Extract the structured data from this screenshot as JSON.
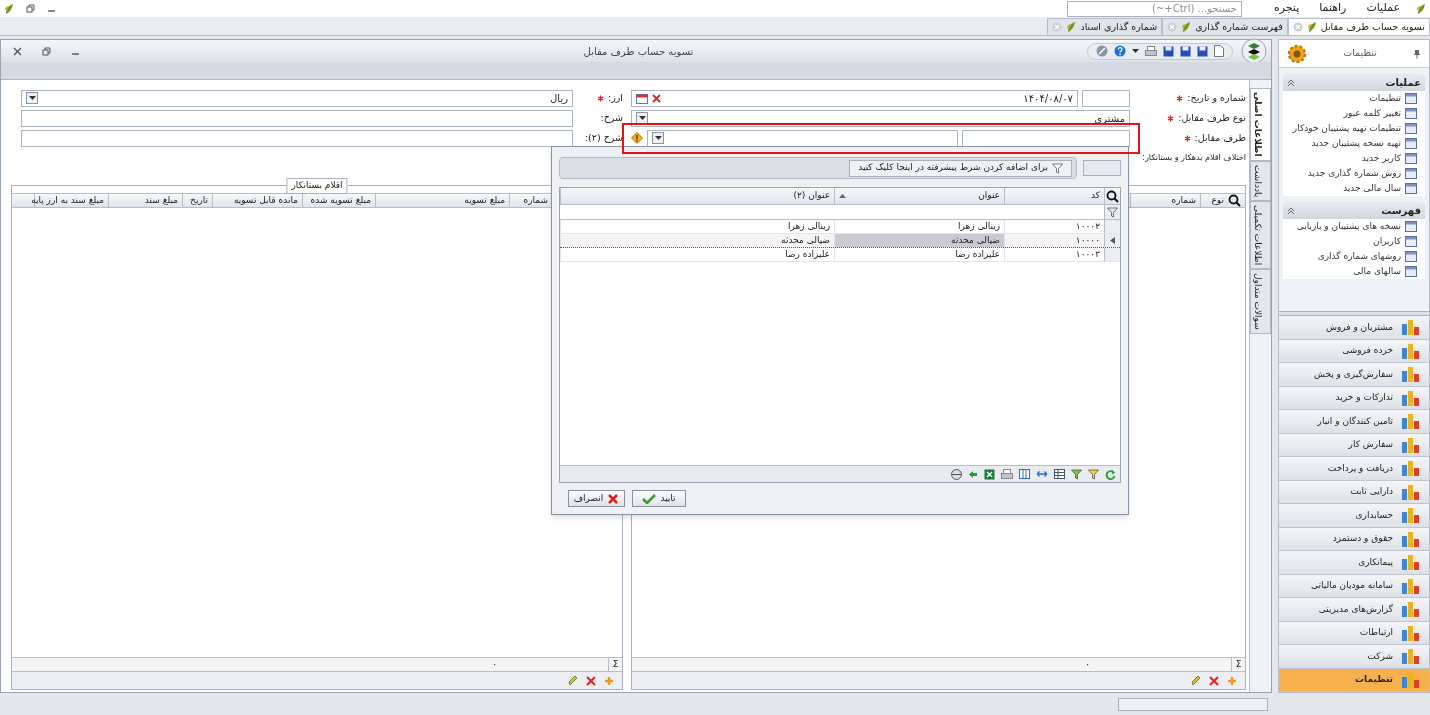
{
  "menu_bar": {
    "items": [
      "عملیات",
      "راهنما",
      "پنجره"
    ],
    "search": {
      "placeholder": "جستجو... (Ctrl+~)"
    }
  },
  "tabs": [
    {
      "label": "تسویه حساب طرف مقابل",
      "selected": true
    },
    {
      "label": "فهرست شماره گذاری",
      "selected": false
    },
    {
      "label": "شماره گذاری اسناد",
      "selected": false
    }
  ],
  "window": {
    "title": "تسویه حساب طرف مقابل"
  },
  "side_tabs": [
    {
      "label": "اطلاعات اصلی",
      "selected": true
    },
    {
      "label": "یادداشت",
      "selected": false
    },
    {
      "label": "اطلاعات تکمیلی",
      "selected": false
    },
    {
      "label": "سوالات متداول",
      "selected": false
    }
  ],
  "form_right": [
    {
      "kind": "number_date",
      "label": "شماره و تاریخ:",
      "required": true,
      "value": "۱۴۰۴/۰۸/۰۷"
    },
    {
      "kind": "combo",
      "label": "نوع طرف مقابل:",
      "required": true,
      "value": "مشتری"
    },
    {
      "kind": "lookup",
      "label": "طرف مقابل:",
      "required": true
    },
    {
      "kind": "caption",
      "label": "اختلاف اقلام بدهکار و بستانکار:",
      "required": false
    }
  ],
  "form_left": [
    {
      "kind": "combo",
      "label": "ارز:",
      "required": true,
      "value": "ریال"
    },
    {
      "kind": "text",
      "label": "شرح:",
      "required": false
    },
    {
      "kind": "text",
      "label": "شرح (۲):",
      "required": false
    }
  ],
  "debit_grid": {
    "columns": [
      "نوع",
      "شماره"
    ],
    "sum_symbol": "Σ",
    "total": "۰"
  },
  "credit_grid": {
    "title": "اقلام بستانکار",
    "columns": [
      "شماره",
      "مبلغ تسویه",
      "مبلغ تسویه شده",
      "مانده قابل تسویه",
      "تاریخ",
      "مبلغ سند",
      "مبلغ سند به ارز پایه"
    ],
    "sum_symbol": "Σ",
    "total": "۰"
  },
  "lookup_popup": {
    "filter_button": "برای اضافه کردن شرط پیشرفته در اینجا کلیک کنید",
    "columns": [
      "کد",
      "عنوان",
      "عنوان (۲)"
    ],
    "rows": [
      {
        "cells": [
          "۱۰۰۰۲",
          "زینالی  زهرا",
          "زینالی  زهرا"
        ],
        "selected": false
      },
      {
        "cells": [
          "۱۰۰۰۰",
          "ضیالی محدثه",
          "ضیالی محدثه"
        ],
        "selected": true
      },
      {
        "cells": [
          "۱۰۰۰۳",
          "علیزاده رضا",
          "علیزاده رضا"
        ],
        "selected": false
      }
    ],
    "ok": "تایید",
    "cancel": "انصراف"
  },
  "sidebar": {
    "title": "تنظیمات",
    "sections": [
      {
        "title": "عملیات",
        "expanded": true,
        "items": [
          "تنظیمات",
          "تغییر کلمه عبور",
          "تنظیمات تهیه پشتیبان خودکار",
          "تهیه نسخه پشتیبان جدید",
          "کاربر جدید",
          "روش شماره گذاری جدید",
          "سال مالی جدید"
        ]
      },
      {
        "title": "فهرست",
        "expanded": true,
        "items": [
          "نسخه های پشتیبان و بازیابی",
          "کاربران",
          "روشهای شماره گذاری",
          "سالهای مالی"
        ]
      }
    ],
    "modules": [
      {
        "label": "مشتریان و فروش",
        "selected": false
      },
      {
        "label": "خرده فروشی",
        "selected": false
      },
      {
        "label": "سفارش‌گیری و پخش",
        "selected": false
      },
      {
        "label": "تدارکات و خرید",
        "selected": false
      },
      {
        "label": "تامین کنندگان و انبار",
        "selected": false
      },
      {
        "label": "سفارش کار",
        "selected": false
      },
      {
        "label": "دریافت و پرداخت",
        "selected": false
      },
      {
        "label": "دارایی ثابت",
        "selected": false
      },
      {
        "label": "حسابداری",
        "selected": false
      },
      {
        "label": "حقوق و دستمزد",
        "selected": false
      },
      {
        "label": "پیمانکاری",
        "selected": false
      },
      {
        "label": "سامانه مودیان مالیاتی",
        "selected": false
      },
      {
        "label": "گزارش‌های مدیریتی",
        "selected": false
      },
      {
        "label": "ارتباطات",
        "selected": false
      },
      {
        "label": "شرکت",
        "selected": false
      },
      {
        "label": "تنظیمات",
        "selected": true
      }
    ]
  }
}
